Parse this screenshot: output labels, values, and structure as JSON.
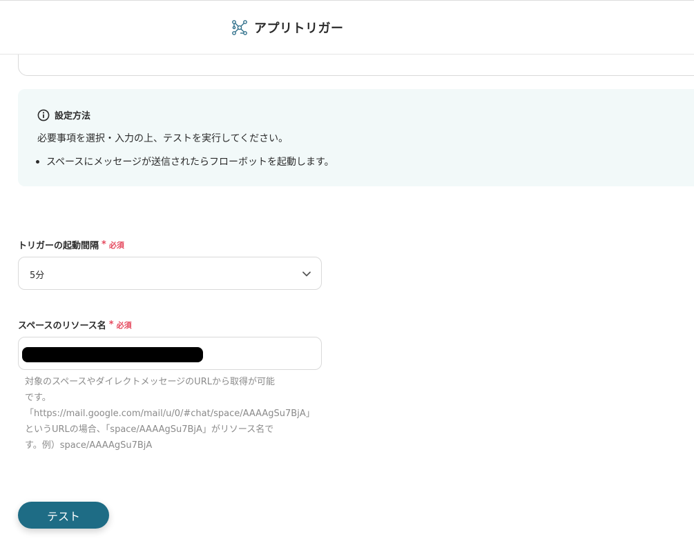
{
  "header": {
    "title": "アプリトリガー",
    "icon": "network-nodes-icon"
  },
  "info": {
    "title": "設定方法",
    "description": "必要事項を選択・入力の上、テストを実行してください。",
    "bullets": [
      "スペースにメッセージが送信されたらフローボットを起動します。"
    ]
  },
  "fields": {
    "interval": {
      "label": "トリガーの起動間隔",
      "required_mark": "*",
      "required_text": "必須",
      "value": "5分"
    },
    "space_resource": {
      "label": "スペースのリソース名",
      "required_mark": "*",
      "required_text": "必須",
      "help_lines": [
        "対象のスペースやダイレクトメッセージのURLから取得が可能",
        "です。",
        "「https://mail.google.com/mail/u/0/#chat/space/AAAAgSu7BjA」",
        "というURLの場合、「space/AAAAgSu7BjA」がリソース名で",
        "す。例）space/AAAAgSu7BjA"
      ]
    }
  },
  "actions": {
    "test_label": "テスト"
  },
  "colors": {
    "accent": "#1e6c85",
    "required": "#e5485d",
    "info_bg": "#f2f9f9"
  }
}
